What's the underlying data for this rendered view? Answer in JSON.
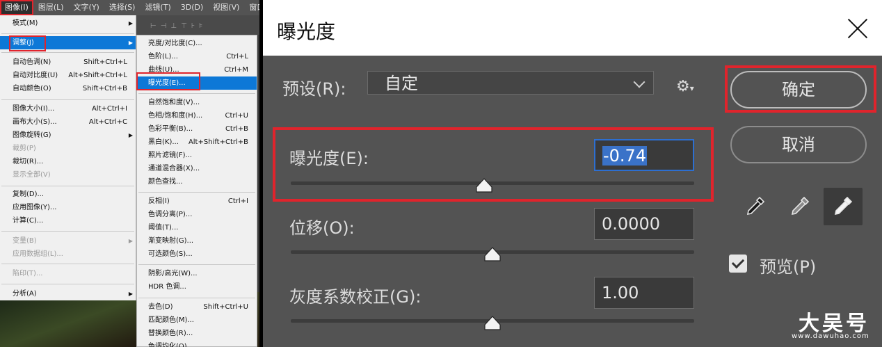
{
  "menubar": {
    "items": [
      "图像(I)",
      "图层(L)",
      "文字(Y)",
      "选择(S)",
      "滤镜(T)",
      "3D(D)",
      "视图(V)",
      "窗口("
    ],
    "active": "图像(I)"
  },
  "image_menu": {
    "items": [
      {
        "label": "模式(M)",
        "shortcut": "",
        "submenu": true,
        "disabled": false
      },
      {
        "label": "调整(J)",
        "shortcut": "",
        "submenu": true,
        "disabled": false,
        "highlighted": true
      },
      {
        "label": "自动色调(N)",
        "shortcut": "Shift+Ctrl+L",
        "submenu": false,
        "disabled": false
      },
      {
        "label": "自动对比度(U)",
        "shortcut": "Alt+Shift+Ctrl+L",
        "submenu": false,
        "disabled": false
      },
      {
        "label": "自动颜色(O)",
        "shortcut": "Shift+Ctrl+B",
        "submenu": false,
        "disabled": false
      },
      {
        "label": "图像大小(I)...",
        "shortcut": "Alt+Ctrl+I",
        "submenu": false,
        "disabled": false
      },
      {
        "label": "画布大小(S)...",
        "shortcut": "Alt+Ctrl+C",
        "submenu": false,
        "disabled": false
      },
      {
        "label": "图像旋转(G)",
        "shortcut": "",
        "submenu": true,
        "disabled": false
      },
      {
        "label": "裁剪(P)",
        "shortcut": "",
        "submenu": false,
        "disabled": true
      },
      {
        "label": "裁切(R)...",
        "shortcut": "",
        "submenu": false,
        "disabled": false
      },
      {
        "label": "显示全部(V)",
        "shortcut": "",
        "submenu": false,
        "disabled": true
      },
      {
        "label": "复制(D)...",
        "shortcut": "",
        "submenu": false,
        "disabled": false
      },
      {
        "label": "应用图像(Y)...",
        "shortcut": "",
        "submenu": false,
        "disabled": false
      },
      {
        "label": "计算(C)...",
        "shortcut": "",
        "submenu": false,
        "disabled": false
      },
      {
        "label": "变量(B)",
        "shortcut": "",
        "submenu": true,
        "disabled": true
      },
      {
        "label": "应用数据组(L)...",
        "shortcut": "",
        "submenu": false,
        "disabled": true
      },
      {
        "label": "陷印(T)...",
        "shortcut": "",
        "submenu": false,
        "disabled": true
      },
      {
        "label": "分析(A)",
        "shortcut": "",
        "submenu": true,
        "disabled": false
      }
    ]
  },
  "adjust_menu": {
    "items": [
      {
        "label": "亮度/对比度(C)...",
        "shortcut": ""
      },
      {
        "label": "色阶(L)...",
        "shortcut": "Ctrl+L"
      },
      {
        "label": "曲线(U)...",
        "shortcut": "Ctrl+M"
      },
      {
        "label": "曝光度(E)...",
        "shortcut": "",
        "highlighted": true
      },
      {
        "label": "自然饱和度(V)...",
        "shortcut": ""
      },
      {
        "label": "色相/饱和度(H)...",
        "shortcut": "Ctrl+U"
      },
      {
        "label": "色彩平衡(B)...",
        "shortcut": "Ctrl+B"
      },
      {
        "label": "黑白(K)...",
        "shortcut": "Alt+Shift+Ctrl+B"
      },
      {
        "label": "照片滤镜(F)...",
        "shortcut": ""
      },
      {
        "label": "通道混合器(X)...",
        "shortcut": ""
      },
      {
        "label": "颜色查找...",
        "shortcut": ""
      },
      {
        "label": "反相(I)",
        "shortcut": "Ctrl+I"
      },
      {
        "label": "色调分离(P)...",
        "shortcut": ""
      },
      {
        "label": "阈值(T)...",
        "shortcut": ""
      },
      {
        "label": "渐变映射(G)...",
        "shortcut": ""
      },
      {
        "label": "可选颜色(S)...",
        "shortcut": ""
      },
      {
        "label": "阴影/高光(W)...",
        "shortcut": ""
      },
      {
        "label": "HDR 色调...",
        "shortcut": ""
      },
      {
        "label": "去色(D)",
        "shortcut": "Shift+Ctrl+U"
      },
      {
        "label": "匹配颜色(M)...",
        "shortcut": ""
      },
      {
        "label": "替换颜色(R)...",
        "shortcut": ""
      },
      {
        "label": "色调均化(Q)",
        "shortcut": ""
      }
    ]
  },
  "dialog": {
    "title": "曝光度",
    "preset_label": "预设(R):",
    "preset_value": "自定",
    "exposure_label": "曝光度(E):",
    "exposure_value": "-0.74",
    "exposure_slider": 0.48,
    "offset_label": "位移(O):",
    "offset_value": "0.0000",
    "offset_slider": 0.5,
    "gamma_label": "灰度系数校正(G):",
    "gamma_value": "1.00",
    "gamma_slider": 0.5,
    "ok_label": "确定",
    "cancel_label": "取消",
    "preview_label": "预览(P)",
    "preview_checked": true
  },
  "watermark": {
    "main": "大吴号",
    "sub": "www.dawuhao.com"
  },
  "colors": {
    "accent_red": "#e0242c",
    "highlight_blue": "#0d78d7",
    "dialog_bg": "#535353"
  }
}
